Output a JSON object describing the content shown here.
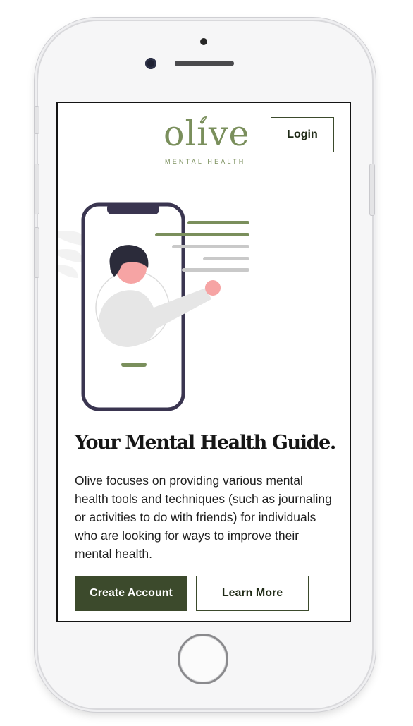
{
  "header": {
    "logo_word": "olive",
    "logo_tagline": "MENTAL HEALTH",
    "login_label": "Login"
  },
  "hero": {
    "headline": "Your Mental Health Guide.",
    "description": "Olive focuses on providing various mental health tools and techniques (such as journaling or activities to do with friends) for individuals who are looking for ways to improve their mental health.",
    "primary_button": "Create Account",
    "secondary_button": "Learn More"
  },
  "colors": {
    "brand_green": "#7a8f5c",
    "dark_green": "#3c4a2c",
    "phone_outline": "#3a3550",
    "accent_pink": "#f6a4a4"
  }
}
